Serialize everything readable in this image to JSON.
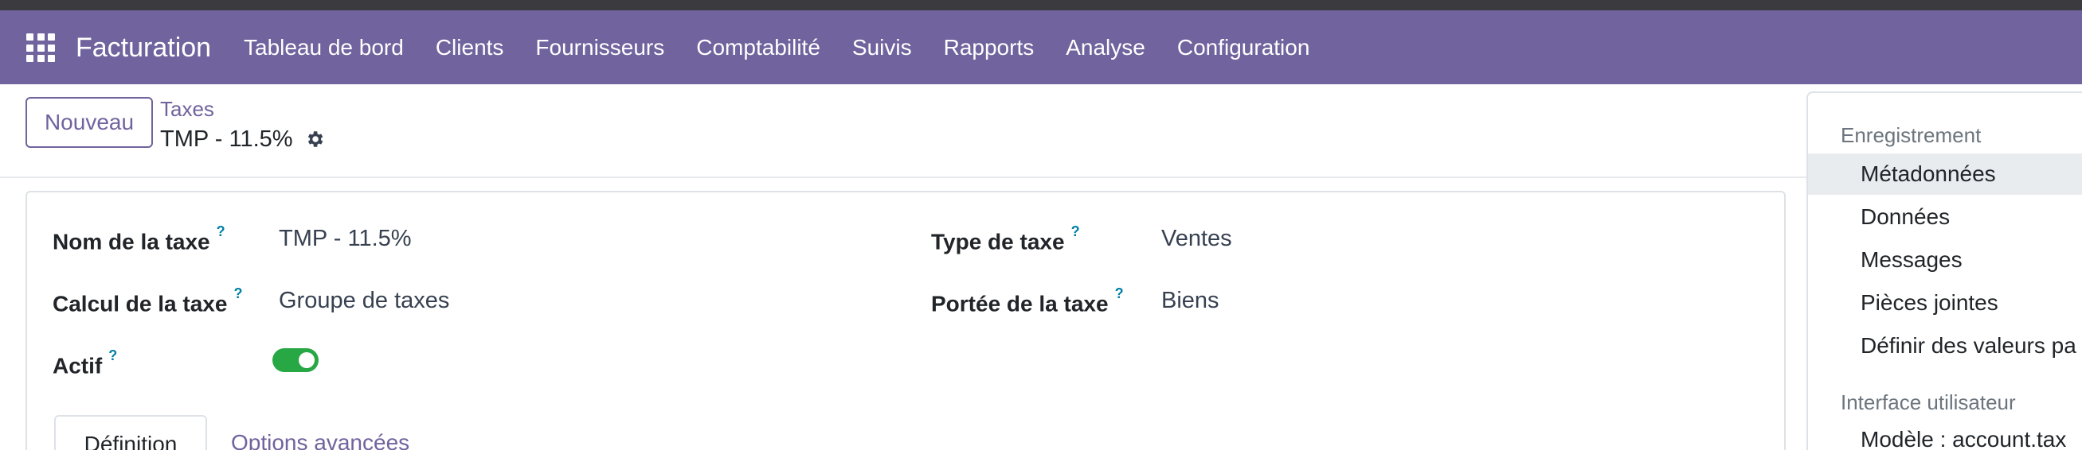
{
  "navbar": {
    "app_title": "Facturation",
    "menu": [
      "Tableau de bord",
      "Clients",
      "Fournisseurs",
      "Comptabilité",
      "Suivis",
      "Rapports",
      "Analyse",
      "Configuration"
    ]
  },
  "control_panel": {
    "new_button": "Nouveau",
    "breadcrumb_parent": "Taxes",
    "breadcrumb_current": "TMP - 11.5%"
  },
  "form": {
    "tax_name": {
      "label": "Nom de la taxe",
      "help": "?",
      "value": "TMP - 11.5%"
    },
    "tax_computation": {
      "label": "Calcul de la taxe",
      "help": "?",
      "value": "Groupe de taxes"
    },
    "active": {
      "label": "Actif",
      "help": "?",
      "checked": true
    },
    "tax_type": {
      "label": "Type de taxe",
      "help": "?",
      "value": "Ventes"
    },
    "tax_scope": {
      "label": "Portée de la taxe",
      "help": "?",
      "value": "Biens"
    },
    "tabs": [
      "Définition",
      "Options avancées"
    ]
  },
  "debug_panel": {
    "section_record": "Enregistrement",
    "record_items": [
      "Métadonnées",
      "Données",
      "Messages",
      "Pièces jointes",
      "Définir des valeurs pa"
    ],
    "section_ui": "Interface utilisateur",
    "ui_items": [
      "Modèle : account.tax"
    ]
  },
  "colors": {
    "brand": "#71639e",
    "toggle_on": "#28a745",
    "help": "#0180a5"
  }
}
